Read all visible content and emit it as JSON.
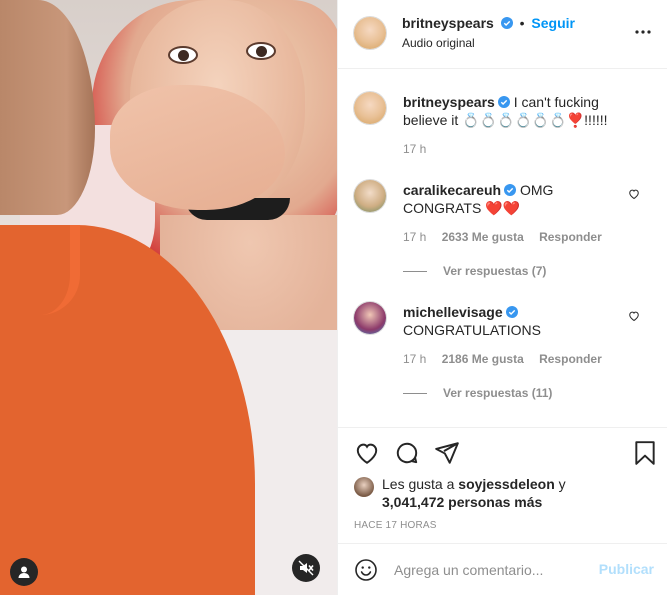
{
  "header": {
    "username": "britneyspears",
    "separator": "•",
    "follow_label": "Seguir",
    "subtitle": "Audio original",
    "more_icon": "more-horizontal-icon"
  },
  "caption": {
    "username": "britneyspears",
    "text": "I can't fucking believe it 💍💍💍💍💍💍❣️!!!!!!",
    "time": "17 h"
  },
  "comments": [
    {
      "username": "caralikecareuh",
      "text": "OMG CONGRATS ❤️❤️",
      "time": "17 h",
      "likes": "2633 Me gusta",
      "reply_label": "Responder",
      "view_replies": "Ver respuestas (7)"
    },
    {
      "username": "michellevisage",
      "text": "CONGRATULATIONS",
      "time": "17 h",
      "likes": "2186 Me gusta",
      "reply_label": "Responder",
      "view_replies": "Ver respuestas (11)"
    }
  ],
  "likes": {
    "prefix": "Les gusta a ",
    "user": "soyjessdeleon",
    "joiner": " y",
    "count": "3,041,472 personas más"
  },
  "date": "HACE 17 HORAS",
  "add_comment": {
    "placeholder": "Agrega un comentario...",
    "publish_label": "Publicar"
  },
  "icons": {
    "like": "heart-icon",
    "comment": "comment-icon",
    "share": "share-icon",
    "save": "bookmark-icon",
    "emoji": "emoji-icon",
    "mute": "muted-icon",
    "tag": "user-tag-icon"
  },
  "colors": {
    "accent": "#0095f6",
    "publish_disabled": "#b2dffc",
    "muted_text": "#8e8e8e",
    "text": "#262626",
    "verified": "#3897f0"
  }
}
